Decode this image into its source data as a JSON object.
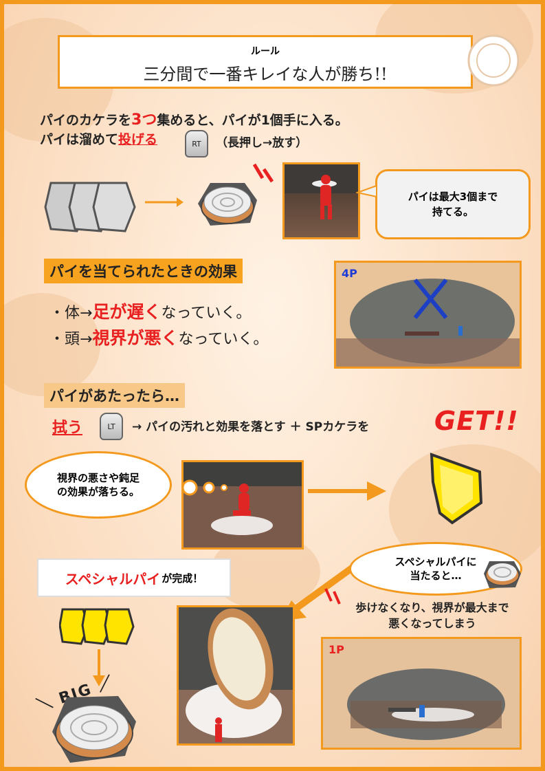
{
  "rules": {
    "heading": "ルール",
    "main": "三分間で一番キレイな人が勝ち!!"
  },
  "intro": {
    "line1_a": "パイのカケラを",
    "line1_red": "3つ",
    "line1_b": "集めると、パイが1個手に入る。",
    "line2_a": "パイは溜めて",
    "line2_red": "投げる",
    "rt_label": "RT",
    "line2_b": "（長押し→放す）"
  },
  "bubble_max": "パイは最大3個まで\n持てる。",
  "effects": {
    "heading": "パイを当てられたときの効果",
    "item1_a": "・体→",
    "item1_red": "足が遅く",
    "item1_b": "なっていく。",
    "item2_a": "・頭→",
    "item2_red": "視界が悪く",
    "item2_b": "なっていく。",
    "player_label": "4P"
  },
  "hit": {
    "heading": "パイがあたったら…",
    "wipe_red": "拭う",
    "lt_label": "LT",
    "line": "→ パイの汚れと効果を落とす ＋ SPカケラを",
    "get": "GET!!"
  },
  "cloud_wipe": "視界の悪さや鈍足\nの効果が落ちる。",
  "special": {
    "name_red": "スペシャルパイ",
    "suffix": "が完成！",
    "big_label": "BIG",
    "bubble": "スペシャルパイに\n当たると…",
    "desc": "歩けなくなり、視界が最大まで\n悪くなってしまう",
    "player_label": "1P"
  },
  "colors": {
    "accent": "#f39a1e",
    "red": "#e82020",
    "heading_bg": "#f7a320"
  }
}
